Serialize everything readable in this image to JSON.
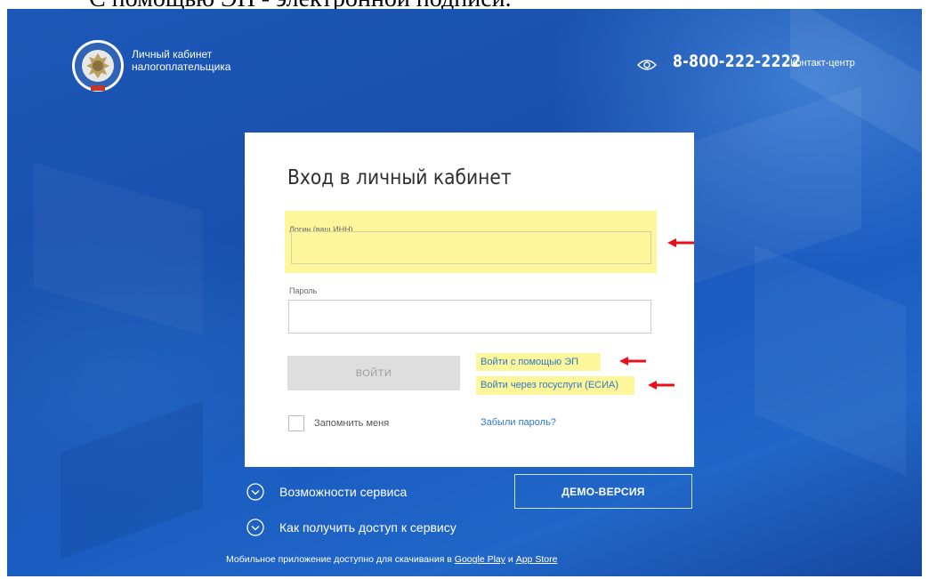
{
  "caption": "С помощью ЭП - электронной подписи.",
  "header": {
    "brand_line1": "Личный кабинет",
    "brand_line2": "налогоплательщика",
    "phone": "8-800-222-2222",
    "contact_label": "Контакт-центр",
    "logo_icon": "fns-emblem-icon",
    "eye_icon": "eye-icon"
  },
  "form": {
    "title": "Вход в личный кабинет",
    "login_label": "Логин (ваш ИНН)",
    "login_value": "",
    "password_label": "Пароль",
    "password_value": "",
    "submit_label": "ВОЙТИ",
    "ep_link": "Войти с помощью ЭП",
    "esia_link": "Войти через госуслуги (ЕСИА)",
    "remember_label": "Запомнить меня",
    "remember_checked": false,
    "forgot_link": "Забыли пароль?"
  },
  "bottom": {
    "features_label": "Возможности сервиса",
    "access_label": "Как получить доступ к сервису",
    "demo_label": "ДЕМО-ВЕРСИЯ",
    "footer_text": "Мобильное приложение доступно для скачивания в",
    "google_play": "Google Play",
    "and": "и",
    "app_store": "App Store"
  },
  "colors": {
    "highlight": "#fdf69a",
    "arrow": "#e8111a",
    "link": "#2f77c2",
    "background": "#1d58b8"
  }
}
